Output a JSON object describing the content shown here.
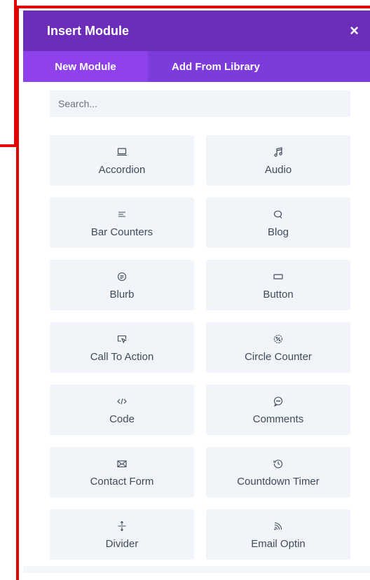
{
  "modal": {
    "title": "Insert Module",
    "close_symbol": "×",
    "tabs": [
      {
        "label": "New Module",
        "active": true
      },
      {
        "label": "Add From Library",
        "active": false
      }
    ],
    "search": {
      "placeholder": "Search...",
      "value": ""
    }
  },
  "modules": [
    {
      "label": "Accordion",
      "icon": "laptop-icon"
    },
    {
      "label": "Audio",
      "icon": "music-icon"
    },
    {
      "label": "Bar Counters",
      "icon": "bars-icon"
    },
    {
      "label": "Blog",
      "icon": "chat-bubble-icon"
    },
    {
      "label": "Blurb",
      "icon": "text-circle-icon"
    },
    {
      "label": "Button",
      "icon": "button-rect-icon"
    },
    {
      "label": "Call To Action",
      "icon": "cursor-box-icon"
    },
    {
      "label": "Circle Counter",
      "icon": "circle-percent-icon"
    },
    {
      "label": "Code",
      "icon": "code-icon"
    },
    {
      "label": "Comments",
      "icon": "comment-bubble-icon"
    },
    {
      "label": "Contact Form",
      "icon": "envelope-icon"
    },
    {
      "label": "Countdown Timer",
      "icon": "clock-rewind-icon"
    },
    {
      "label": "Divider",
      "icon": "divider-arrows-icon"
    },
    {
      "label": "Email Optin",
      "icon": "rss-icon"
    }
  ],
  "colors": {
    "header": "#6c2eb9",
    "tabs_bar": "#7d3bdc",
    "active_tab": "#8f42ec",
    "card_bg": "#f1f5f9",
    "annotation": "#e00000"
  }
}
